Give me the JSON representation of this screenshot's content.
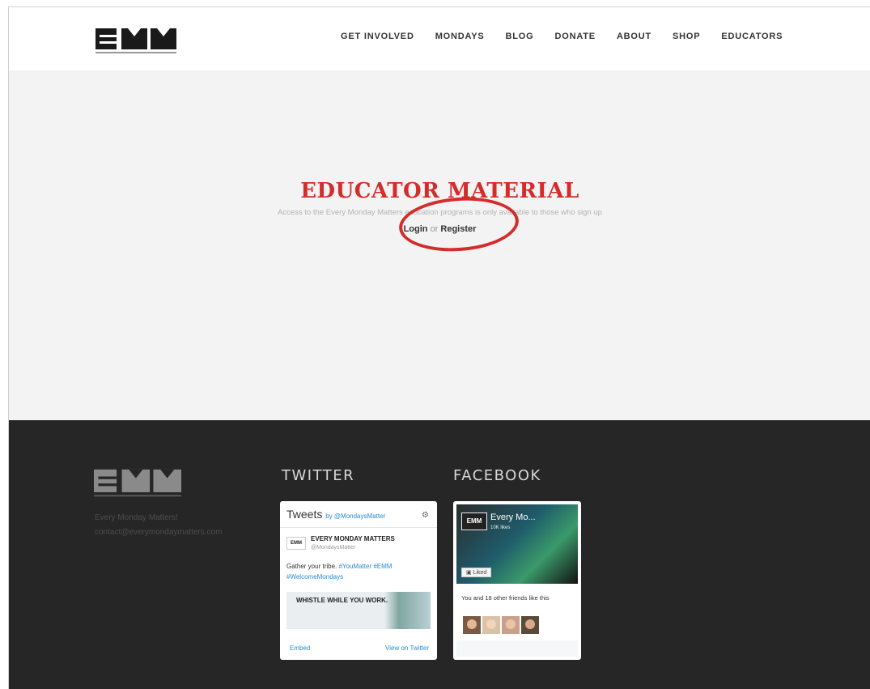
{
  "header": {
    "nav": [
      "GET INVOLVED",
      "MONDAYS",
      "BLOG",
      "DONATE",
      "ABOUT",
      "SHOP",
      "EDUCATORS"
    ]
  },
  "main": {
    "title": "EDUCATOR MATERIAL",
    "subtitle": "Access to the Every Monday Matters education programs is only available to those who sign up",
    "login": "Login",
    "or": "or",
    "register": "Register"
  },
  "footer": {
    "tagline": "Every Monday Matters!",
    "email": "contact@everymondaymatters.com",
    "twitter_heading": "TWITTER",
    "facebook_heading": "FACEBOOK",
    "twitter": {
      "title": "Tweets",
      "by": "by @MondaysMatter",
      "account_name": "EVERY MONDAY MATTERS",
      "handle": "@MondaysMatter",
      "avatar_text": "EMM",
      "message": "Gather your tribe.",
      "hashtags": "#YouMatter #EMM #WelcomeMondays",
      "image_text": "WHISTLE WHILE YOU WORK.",
      "embed": "Embed",
      "view": "View on Twitter"
    },
    "facebook": {
      "page_name": "Every Mo...",
      "likes": "10K likes",
      "logo_text": "EMM",
      "liked": "Liked",
      "friends_text": "You and 18 other friends like this"
    }
  }
}
